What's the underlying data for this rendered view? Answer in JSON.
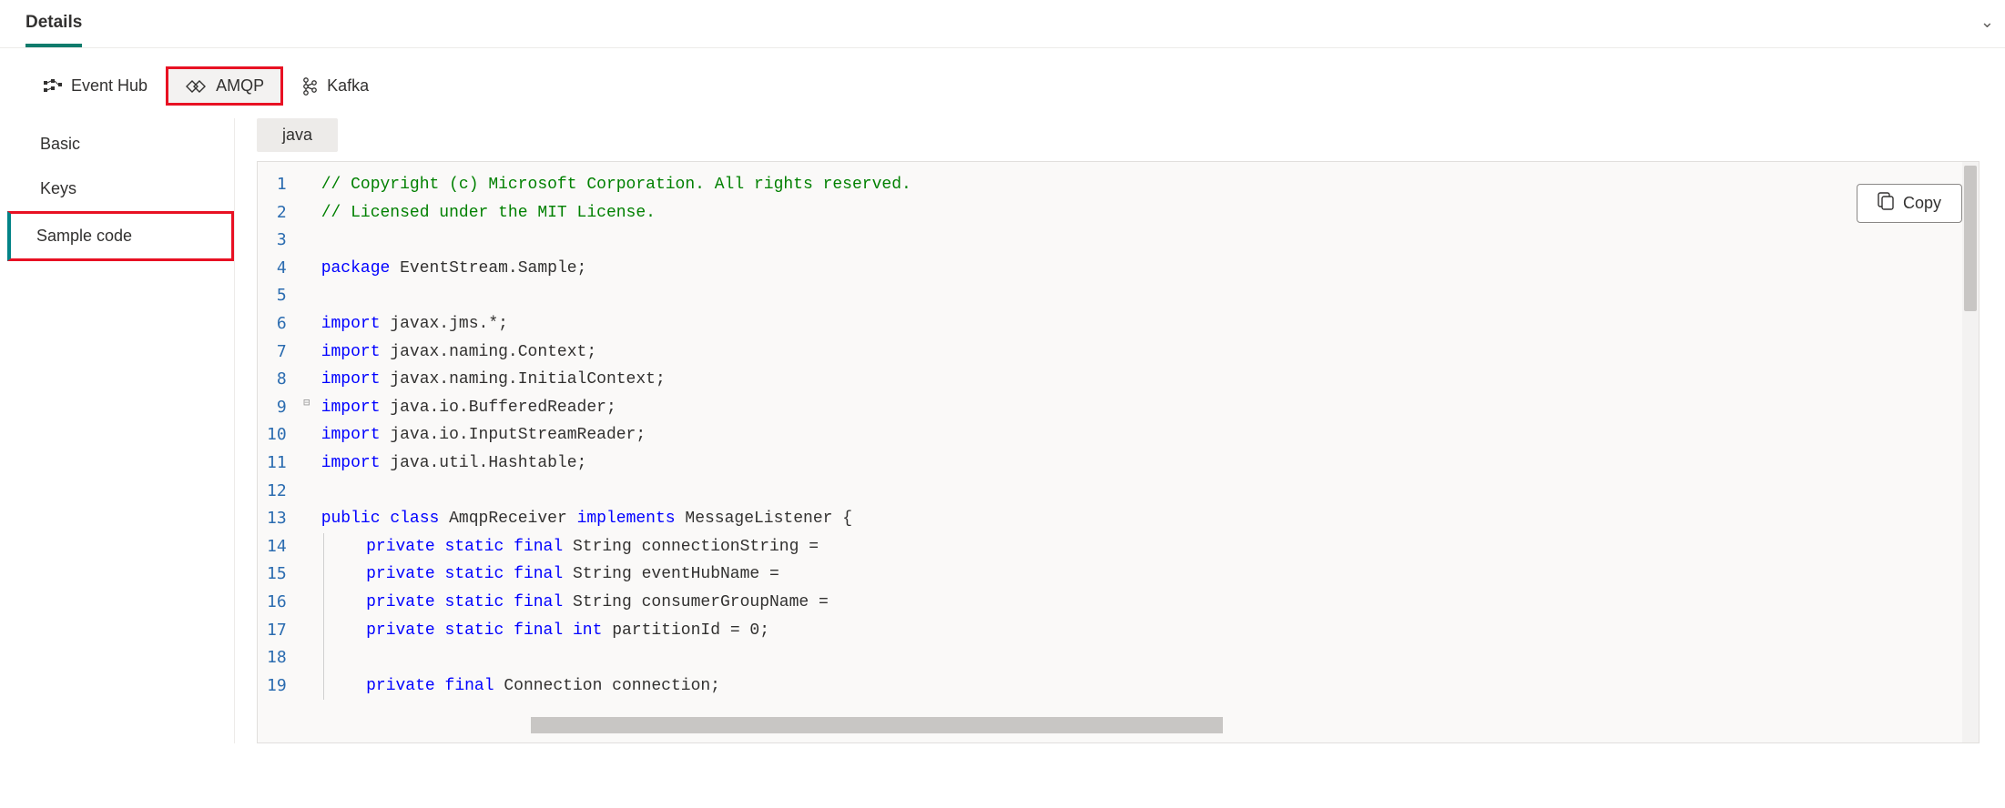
{
  "header": {
    "tab_label": "Details"
  },
  "protocol_tabs": [
    {
      "id": "eventhub",
      "label": "Event Hub",
      "selected": false
    },
    {
      "id": "amqp",
      "label": "AMQP",
      "selected": true
    },
    {
      "id": "kafka",
      "label": "Kafka",
      "selected": false
    }
  ],
  "side_nav": [
    {
      "id": "basic",
      "label": "Basic",
      "active": false
    },
    {
      "id": "keys",
      "label": "Keys",
      "active": false
    },
    {
      "id": "samplecode",
      "label": "Sample code",
      "active": true
    }
  ],
  "language_chip": "java",
  "copy_button_label": "Copy",
  "code": {
    "lines": [
      {
        "n": 1,
        "t": "comment",
        "text": "// Copyright (c) Microsoft Corporation. All rights reserved."
      },
      {
        "n": 2,
        "t": "comment",
        "text": "// Licensed under the MIT License."
      },
      {
        "n": 3,
        "t": "blank",
        "text": ""
      },
      {
        "n": 4,
        "t": "pkg",
        "kw": "package",
        "rest": " EventStream.Sample;"
      },
      {
        "n": 5,
        "t": "blank",
        "text": ""
      },
      {
        "n": 6,
        "t": "imp",
        "kw": "import",
        "rest": " javax.jms.*;"
      },
      {
        "n": 7,
        "t": "imp",
        "kw": "import",
        "rest": " javax.naming.Context;"
      },
      {
        "n": 8,
        "t": "imp",
        "kw": "import",
        "rest": " javax.naming.InitialContext;"
      },
      {
        "n": 9,
        "t": "imp",
        "kw": "import",
        "rest": " java.io.BufferedReader;"
      },
      {
        "n": 10,
        "t": "imp",
        "kw": "import",
        "rest": " java.io.InputStreamReader;"
      },
      {
        "n": 11,
        "t": "imp",
        "kw": "import",
        "rest": " java.util.Hashtable;"
      },
      {
        "n": 12,
        "t": "blank",
        "text": ""
      },
      {
        "n": 13,
        "t": "classdecl",
        "fold": true,
        "tokens": [
          {
            "c": "key",
            "v": "public"
          },
          {
            "c": "",
            "v": " "
          },
          {
            "c": "key",
            "v": "class"
          },
          {
            "c": "",
            "v": " AmqpReceiver "
          },
          {
            "c": "key",
            "v": "implements"
          },
          {
            "c": "",
            "v": " MessageListener {"
          }
        ]
      },
      {
        "n": 14,
        "t": "field",
        "indent": 1,
        "tokens": [
          {
            "c": "key",
            "v": "private"
          },
          {
            "c": "",
            "v": " "
          },
          {
            "c": "key",
            "v": "static"
          },
          {
            "c": "",
            "v": " "
          },
          {
            "c": "key",
            "v": "final"
          },
          {
            "c": "",
            "v": " String connectionString ="
          }
        ]
      },
      {
        "n": 15,
        "t": "field",
        "indent": 1,
        "tokens": [
          {
            "c": "key",
            "v": "private"
          },
          {
            "c": "",
            "v": " "
          },
          {
            "c": "key",
            "v": "static"
          },
          {
            "c": "",
            "v": " "
          },
          {
            "c": "key",
            "v": "final"
          },
          {
            "c": "",
            "v": " String eventHubName ="
          }
        ]
      },
      {
        "n": 16,
        "t": "field",
        "indent": 1,
        "tokens": [
          {
            "c": "key",
            "v": "private"
          },
          {
            "c": "",
            "v": " "
          },
          {
            "c": "key",
            "v": "static"
          },
          {
            "c": "",
            "v": " "
          },
          {
            "c": "key",
            "v": "final"
          },
          {
            "c": "",
            "v": " String consumerGroupName ="
          }
        ]
      },
      {
        "n": 17,
        "t": "field",
        "indent": 1,
        "tokens": [
          {
            "c": "key",
            "v": "private"
          },
          {
            "c": "",
            "v": " "
          },
          {
            "c": "key",
            "v": "static"
          },
          {
            "c": "",
            "v": " "
          },
          {
            "c": "key",
            "v": "final"
          },
          {
            "c": "",
            "v": " "
          },
          {
            "c": "key",
            "v": "int"
          },
          {
            "c": "",
            "v": " partitionId = 0;"
          }
        ]
      },
      {
        "n": 18,
        "t": "blank-inblock",
        "text": ""
      },
      {
        "n": 19,
        "t": "field",
        "indent": 1,
        "tokens": [
          {
            "c": "key",
            "v": "private"
          },
          {
            "c": "",
            "v": " "
          },
          {
            "c": "key",
            "v": "final"
          },
          {
            "c": "",
            "v": " Connection connection;"
          }
        ]
      }
    ]
  }
}
